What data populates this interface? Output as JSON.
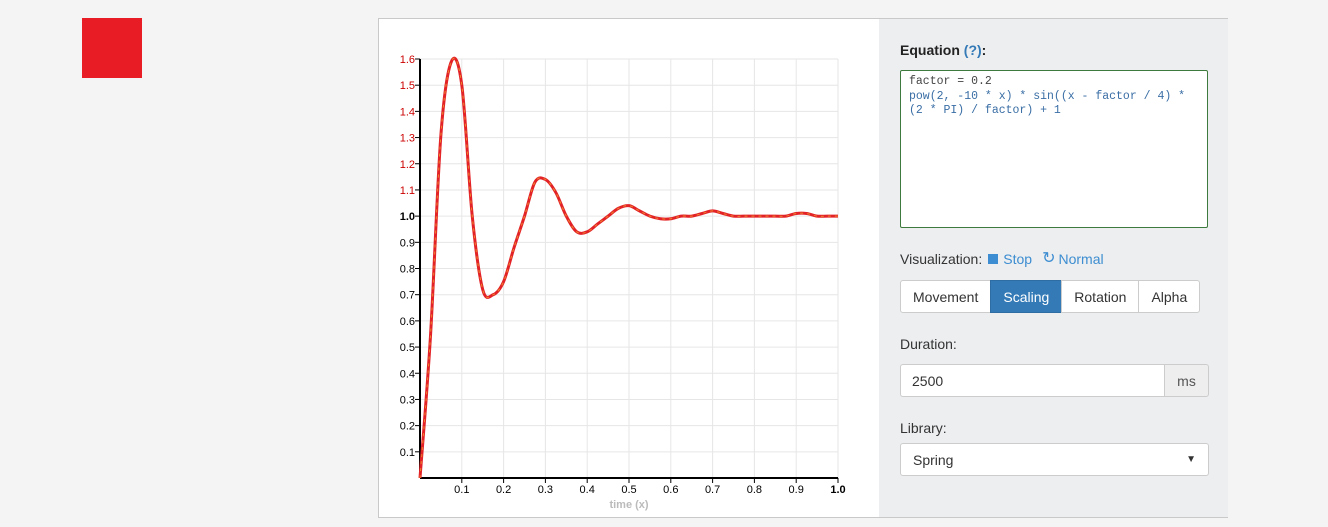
{
  "colors": {
    "square": "#e81c24",
    "curve": "#e32227",
    "accent": "#337ab7",
    "ytick_red": "#cc0000"
  },
  "equation": {
    "label": "Equation",
    "help": "(?)",
    "colon": ":",
    "line1": "factor = 0.2",
    "line2": "pow(2, -10 * x) * sin((x - factor / 4) * (2 * PI) / factor) + 1"
  },
  "visualization": {
    "label": "Visualization:",
    "stop_label": "Stop",
    "stop_icon": "stop-square-icon",
    "normal_label": "Normal",
    "normal_icon": "reload-icon",
    "modes": [
      {
        "label": "Movement",
        "active": false
      },
      {
        "label": "Scaling",
        "active": true
      },
      {
        "label": "Rotation",
        "active": false
      },
      {
        "label": "Alpha",
        "active": false
      }
    ]
  },
  "duration": {
    "label": "Duration:",
    "value": "2500",
    "unit": "ms"
  },
  "library": {
    "label": "Library:",
    "selected": "Spring"
  },
  "chart_data": {
    "type": "line",
    "xlabel": "time (x)",
    "ylabel": "",
    "xlim": [
      0,
      1.0
    ],
    "ylim": [
      0,
      1.6
    ],
    "x_ticks": [
      "0.1",
      "0.2",
      "0.3",
      "0.4",
      "0.5",
      "0.6",
      "0.7",
      "0.8",
      "0.9",
      "1.0"
    ],
    "y_ticks": [
      "0.1",
      "0.2",
      "0.3",
      "0.4",
      "0.5",
      "0.6",
      "0.7",
      "0.8",
      "0.9",
      "1.0",
      "1.1",
      "1.2",
      "1.3",
      "1.4",
      "1.5",
      "1.6"
    ],
    "grid": true,
    "series": [
      {
        "x": [
          0,
          0.025,
          0.05,
          0.075,
          0.1,
          0.125,
          0.15,
          0.175,
          0.2,
          0.225,
          0.25,
          0.275,
          0.3,
          0.325,
          0.35,
          0.375,
          0.4,
          0.425,
          0.45,
          0.475,
          0.5,
          0.525,
          0.55,
          0.575,
          0.6,
          0.625,
          0.65,
          0.675,
          0.7,
          0.725,
          0.75,
          0.775,
          0.8,
          0.825,
          0.85,
          0.875,
          0.9,
          0.925,
          0.95,
          0.975,
          1.0
        ],
        "y": [
          0.0,
          0.54,
          1.31,
          1.59,
          1.5,
          1.0,
          0.72,
          0.7,
          0.75,
          0.88,
          1.0,
          1.13,
          1.14,
          1.09,
          1.0,
          0.94,
          0.94,
          0.97,
          1.0,
          1.03,
          1.04,
          1.02,
          1.0,
          0.99,
          0.99,
          1.0,
          1.0,
          1.01,
          1.02,
          1.01,
          1.0,
          1.0,
          1.0,
          1.0,
          1.0,
          1.0,
          1.01,
          1.01,
          1.0,
          1.0,
          1.0
        ]
      }
    ]
  }
}
